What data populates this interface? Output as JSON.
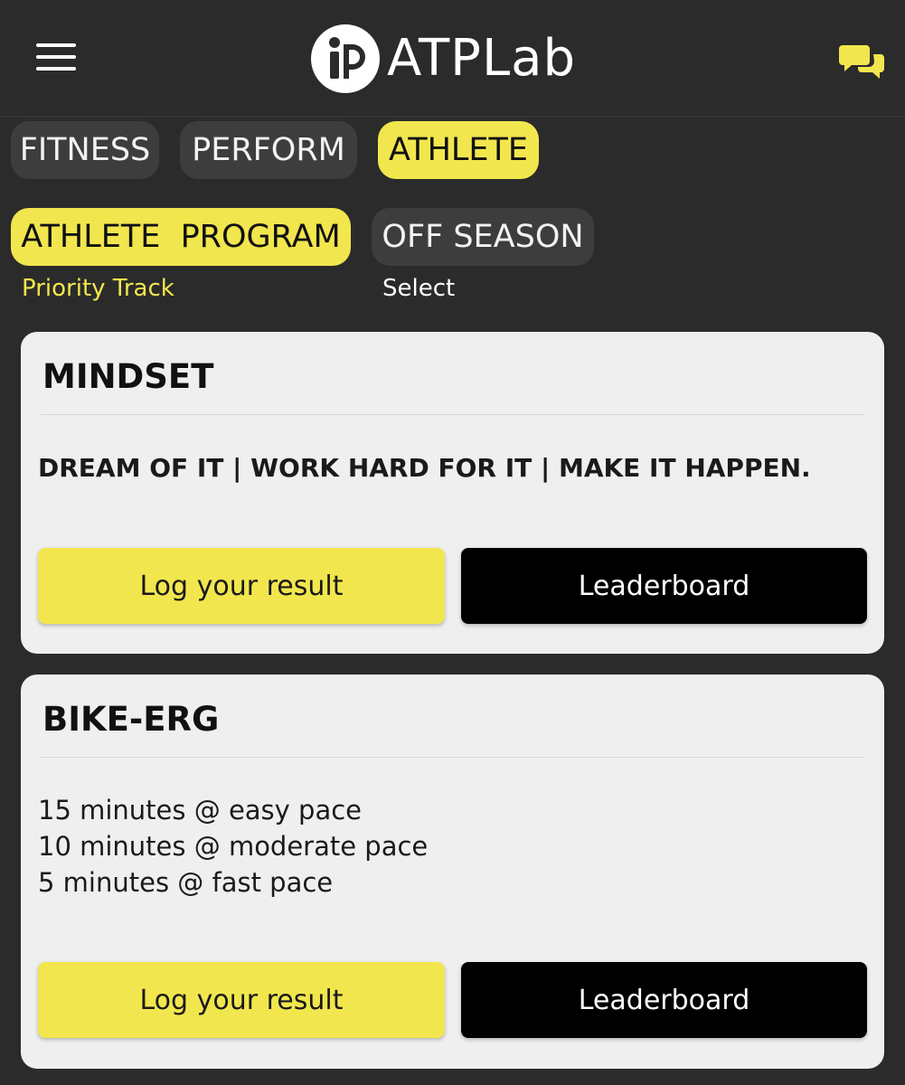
{
  "header": {
    "logo_text": "ATPLab",
    "menu_icon": "hamburger-menu-icon",
    "chat_icon": "chat-bubbles-icon"
  },
  "categories": [
    {
      "label": "FITNESS",
      "active": false
    },
    {
      "label": "PERFORM",
      "active": false
    },
    {
      "label": "ATHLETE",
      "active": true
    }
  ],
  "tracks": [
    {
      "label": "ATHLETE  PROGRAM",
      "sub_label": "Priority Track",
      "active": true
    },
    {
      "label": "OFF SEASON",
      "sub_label": "Select",
      "active": false
    }
  ],
  "cards": [
    {
      "title": "MINDSET",
      "text": "DREAM OF IT | WORK HARD FOR IT | MAKE IT HAPPEN.",
      "log_label": "Log your result",
      "leaderboard_label": "Leaderboard"
    },
    {
      "title": "BIKE-ERG",
      "lines": [
        "15 minutes @ easy pace",
        "10 minutes @ moderate pace",
        "5 minutes @ fast pace"
      ],
      "log_label": "Log your result",
      "leaderboard_label": "Leaderboard"
    }
  ],
  "colors": {
    "background": "#2b2b2b",
    "accent": "#f2e64e",
    "chip_inactive": "#3d3d3d",
    "card": "#efefef"
  }
}
